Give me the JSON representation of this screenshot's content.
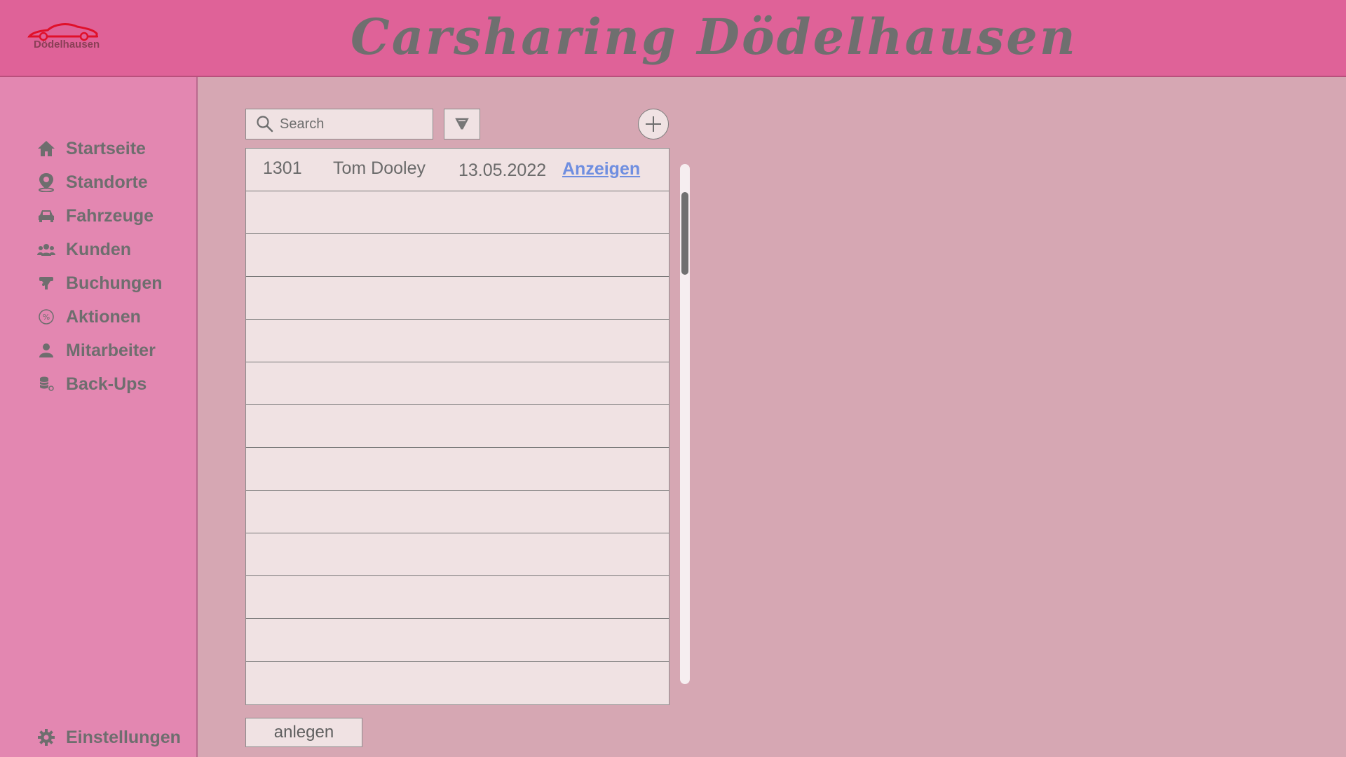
{
  "header": {
    "logo_text": "Dödelhausen",
    "title": "Carsharing Dödelhausen"
  },
  "colors": {
    "header_bg": "#df6298",
    "sidebar_bg": "#e387b1",
    "content_bg": "#d6a7b3",
    "list_bg": "#f0e2e3",
    "link": "#6f8ee0",
    "logo_car": "#e0102a"
  },
  "sidebar": {
    "items": [
      {
        "label": "Startseite",
        "icon": "home-icon"
      },
      {
        "label": "Standorte",
        "icon": "location-pin-icon"
      },
      {
        "label": "Fahrzeuge",
        "icon": "car-icon"
      },
      {
        "label": "Kunden",
        "icon": "users-icon"
      },
      {
        "label": "Buchungen",
        "icon": "booking-icon"
      },
      {
        "label": "Aktionen",
        "icon": "percent-icon"
      },
      {
        "label": "Mitarbeiter",
        "icon": "user-icon"
      },
      {
        "label": "Back-Ups",
        "icon": "database-icon"
      }
    ],
    "settings": {
      "label": "Einstellungen",
      "icon": "gear-icon"
    }
  },
  "search": {
    "placeholder": "Search"
  },
  "table": {
    "rows": [
      {
        "id": "1301",
        "name": "Tom Dooley",
        "date": "13.05.2022",
        "action": "Anzeigen"
      },
      {
        "id": "",
        "name": "",
        "date": "",
        "action": ""
      },
      {
        "id": "",
        "name": "",
        "date": "",
        "action": ""
      },
      {
        "id": "",
        "name": "",
        "date": "",
        "action": ""
      },
      {
        "id": "",
        "name": "",
        "date": "",
        "action": ""
      },
      {
        "id": "",
        "name": "",
        "date": "",
        "action": ""
      },
      {
        "id": "",
        "name": "",
        "date": "",
        "action": ""
      },
      {
        "id": "",
        "name": "",
        "date": "",
        "action": ""
      },
      {
        "id": "",
        "name": "",
        "date": "",
        "action": ""
      },
      {
        "id": "",
        "name": "",
        "date": "",
        "action": ""
      },
      {
        "id": "",
        "name": "",
        "date": "",
        "action": ""
      },
      {
        "id": "",
        "name": "",
        "date": "",
        "action": ""
      },
      {
        "id": "",
        "name": "",
        "date": "",
        "action": ""
      }
    ]
  },
  "footer": {
    "create_label": "anlegen"
  }
}
